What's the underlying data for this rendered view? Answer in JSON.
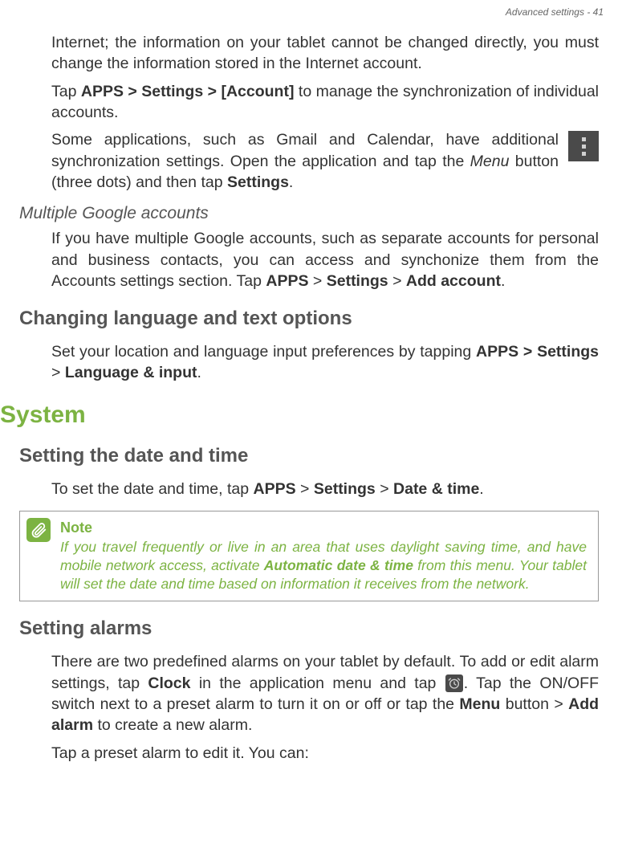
{
  "header": {
    "text": "Advanced settings - 41"
  },
  "paragraphs": {
    "p1a": "Internet; the information on your tablet cannot be changed directly, you must change the information stored in the Internet account.",
    "p1b_pre": "Tap ",
    "p1b_bold": "APPS > Settings > [Account]",
    "p1b_post": " to manage the synchronization of individual accounts.",
    "p1c_pre": "Some applications, such as Gmail and Calendar, have additional synchronization settings. Open the application and tap the ",
    "p1c_italic": "Menu",
    "p1c_mid": " button (three dots) and then tap ",
    "p1c_bold": "Settings",
    "p1c_post": ".",
    "sub1": "Multiple Google accounts",
    "p2_pre": "If you have multiple Google accounts, such as separate accounts for personal and business contacts, you can access and synchonize them from the Accounts settings section. Tap ",
    "p2_b1": "APPS",
    "p2_gt1": " > ",
    "p2_b2": "Settings",
    "p2_gt2": " > ",
    "p2_b3": "Add account",
    "p2_post": ".",
    "h2a": "Changing language and text options",
    "p3_pre": "Set your location and language input preferences by tapping ",
    "p3_b1": "APPS > Settings",
    "p3_gt": " > ",
    "p3_b2": "Language & input",
    "p3_post": ".",
    "h1": "System",
    "h2b": "Setting the date and time",
    "p4_pre": "To set the date and time, tap ",
    "p4_b1": "APPS",
    "p4_gt1": " > ",
    "p4_b2": "Settings",
    "p4_gt2": " > ",
    "p4_b3": "Date & time",
    "p4_post": ".",
    "note_title": "Note",
    "note_pre": "If you travel frequently or live in an area that uses daylight saving time, and have mobile network access, activate ",
    "note_bold": "Automatic date & time",
    "note_post": " from this menu. Your tablet will set the date and time based on information it receives from the network.",
    "h2c": "Setting alarms",
    "p5_pre": "There are two predefined alarms on your tablet by default. To add or edit alarm settings, tap ",
    "p5_b1": "Clock",
    "p5_mid1": " in the application menu and tap ",
    "p5_mid2": ". Tap the ON/OFF switch next to a preset alarm to turn it on or off or tap the ",
    "p5_b2": "Menu",
    "p5_mid3": " button > ",
    "p5_b3": "Add alarm",
    "p5_post": " to create a new alarm.",
    "p6": "Tap a preset alarm to edit it. You can:"
  }
}
